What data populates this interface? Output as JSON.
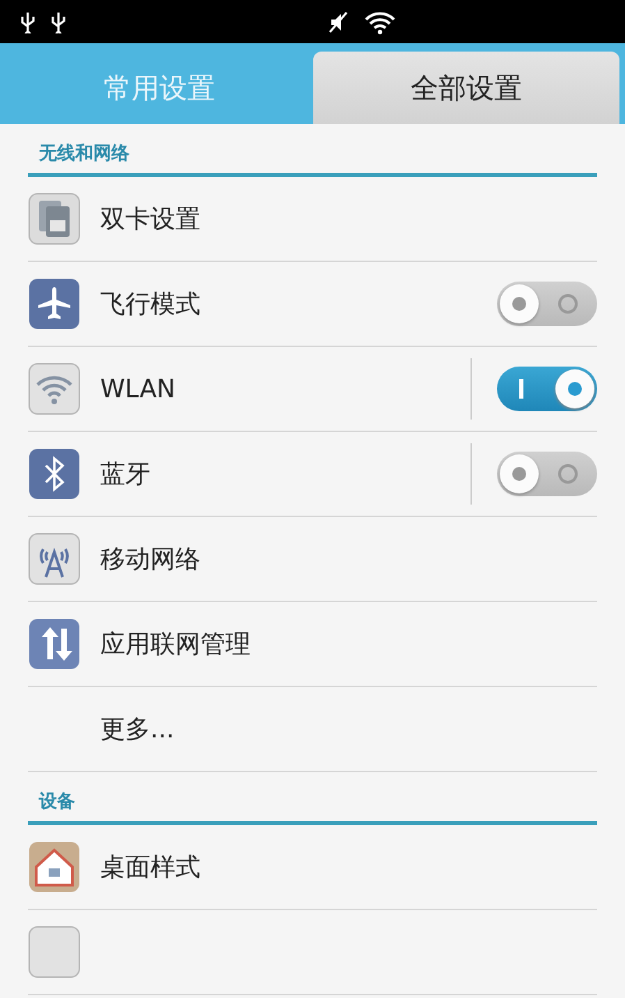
{
  "tabs": [
    {
      "label": "常用设置",
      "selected": false
    },
    {
      "label": "全部设置",
      "selected": true
    }
  ],
  "sections": [
    {
      "title": "无线和网络",
      "items": [
        {
          "kind": "plain",
          "label": "双卡设置"
        },
        {
          "kind": "toggle",
          "label": "飞行模式",
          "on": false
        },
        {
          "kind": "split_toggle",
          "label": "WLAN",
          "on": true
        },
        {
          "kind": "split_toggle",
          "label": "蓝牙",
          "on": false
        },
        {
          "kind": "plain",
          "label": "移动网络"
        },
        {
          "kind": "plain",
          "label": "应用联网管理"
        },
        {
          "kind": "plain",
          "label": "更多..."
        }
      ]
    },
    {
      "title": "设备",
      "items": [
        {
          "kind": "plain",
          "label": "桌面样式"
        },
        {
          "kind": "plain"
        }
      ]
    }
  ]
}
